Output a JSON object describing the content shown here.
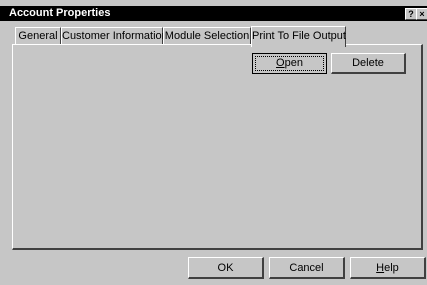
{
  "window": {
    "title": "Account Properties",
    "help_glyph": "?",
    "close_glyph": "×"
  },
  "tabs": [
    {
      "label": "General"
    },
    {
      "label": "Customer Information"
    },
    {
      "label": "Module Selection"
    },
    {
      "label": "Print To File Output",
      "active": true
    }
  ],
  "panel": {
    "open": {
      "first": "O",
      "rest": "pen"
    },
    "delete": "Delete"
  },
  "footer": {
    "ok": "OK",
    "cancel": "Cancel",
    "help": {
      "first": "H",
      "rest": "elp"
    }
  }
}
